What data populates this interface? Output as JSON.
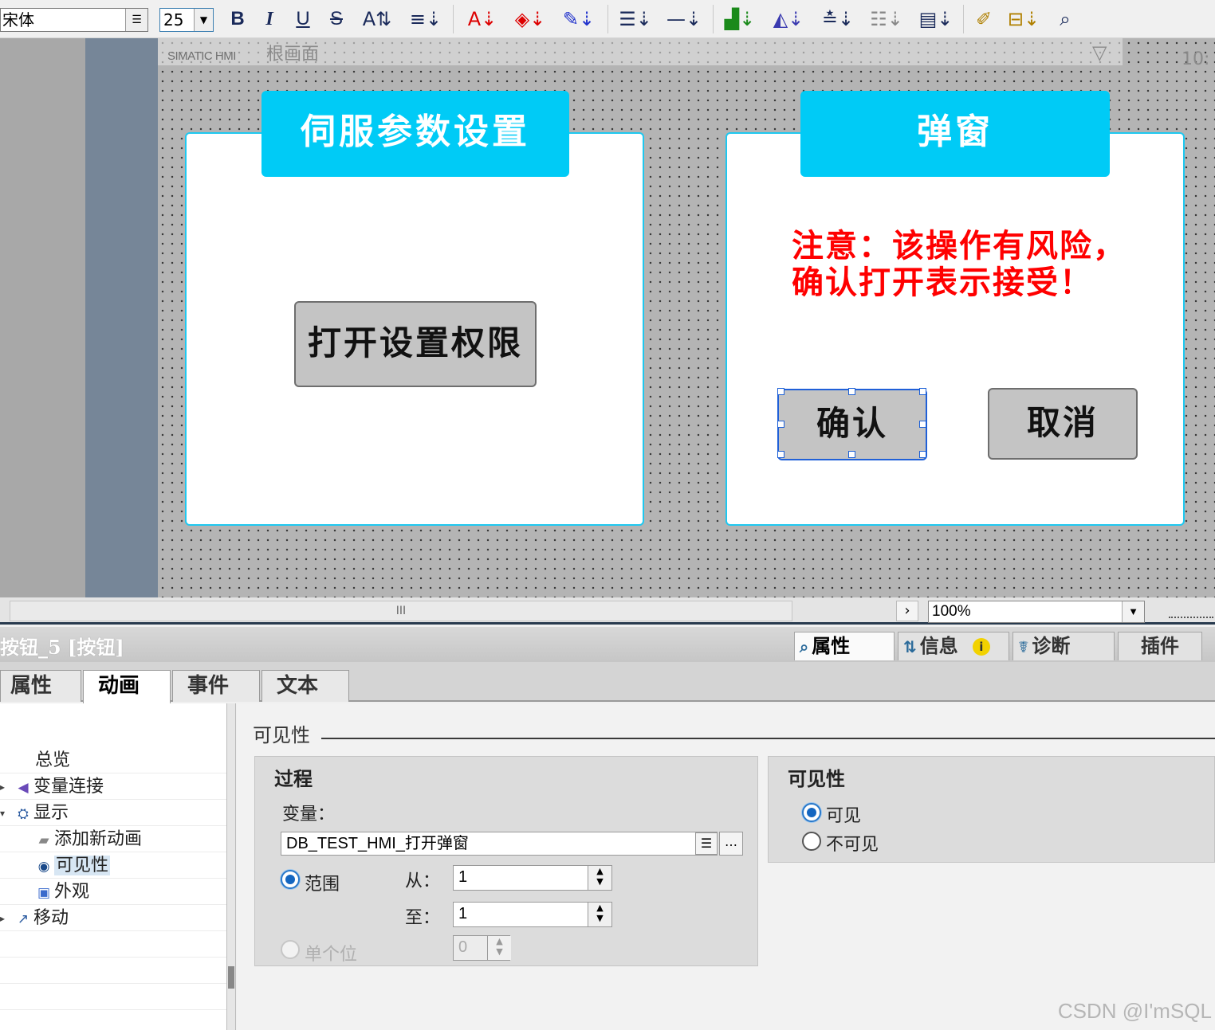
{
  "toolbar": {
    "font_name": "宋体",
    "font_size": "25",
    "bold": "B",
    "italic": "I",
    "underline": "U",
    "strike": "S"
  },
  "canvas": {
    "brand": "SIMATIC HMI",
    "screen_title": "根画面",
    "time": "10:",
    "panel_left": {
      "title": "伺服参数设置",
      "button": "打开设置权限"
    },
    "panel_right": {
      "title": "弹窗",
      "warning_line1": "注意：该操作有风险，",
      "warning_line2": "确认打开表示接受！",
      "confirm": "确认",
      "cancel": "取消"
    }
  },
  "scroll": {
    "zoom": "100%",
    "grip": "III"
  },
  "inspector": {
    "object_title": "按钮_5 [按钮]",
    "tabs": [
      "属性",
      "信息",
      "诊断",
      "插件"
    ],
    "info_badge": "i",
    "sub_tabs": [
      "属性",
      "动画",
      "事件",
      "文本"
    ]
  },
  "tree": {
    "items": [
      "总览",
      "变量连接",
      "显示",
      "添加新动画",
      "可见性",
      "外观",
      "移动"
    ]
  },
  "visibility": {
    "section": "可见性",
    "process": {
      "title": "过程",
      "variable_label": "变量：",
      "variable_value": "DB_TEST_HMI_打开弹窗",
      "range_label": "范围",
      "from_label": "从：",
      "from_value": "1",
      "to_label": "至：",
      "to_value": "1",
      "single_bit_label": "单个位",
      "single_bit_value": "0"
    },
    "visibility_group": {
      "title": "可见性",
      "visible": "可见",
      "invisible": "不可见"
    }
  },
  "watermark": "CSDN @I'mSQL"
}
